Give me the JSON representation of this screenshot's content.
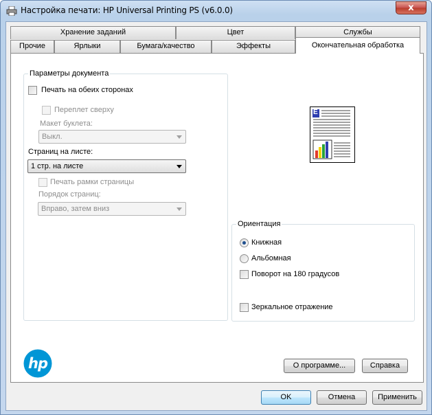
{
  "window": {
    "title": "Настройка печати: HP Universal Printing PS (v6.0.0)",
    "close_symbol": "x"
  },
  "tabs": {
    "back_row": [
      "Хранение заданий",
      "Цвет",
      "Службы"
    ],
    "front_row": [
      "Прочие",
      "Ярлыки",
      "Бумага/качество",
      "Эффекты"
    ],
    "active": "Окончательная обработка"
  },
  "document_options": {
    "group_label": "Параметры документа",
    "duplex_label": "Печать на обеих сторонах",
    "flip_up_label": "Переплет сверху",
    "booklet_label": "Макет буклета:",
    "booklet_value": "Выкл.",
    "pages_per_sheet_label": "Страниц на листе:",
    "pages_per_sheet_value": "1 стр. на листе",
    "print_borders_label": "Печать рамки страницы",
    "page_order_label": "Порядок страниц:",
    "page_order_value": "Вправо, затем вниз"
  },
  "orientation": {
    "group_label": "Ориентация",
    "portrait_label": "Книжная",
    "landscape_label": "Альбомная",
    "rotate_label": "Поворот на 180 градусов",
    "mirror_label": "Зеркальное отражение",
    "selected": "portrait"
  },
  "preview": {
    "letter": "E"
  },
  "logo": {
    "text": "hp",
    "color": "#0096d6"
  },
  "buttons": {
    "about": "О программе...",
    "help": "Справка",
    "ok": "OK",
    "cancel": "Отмена",
    "apply": "Применить"
  }
}
